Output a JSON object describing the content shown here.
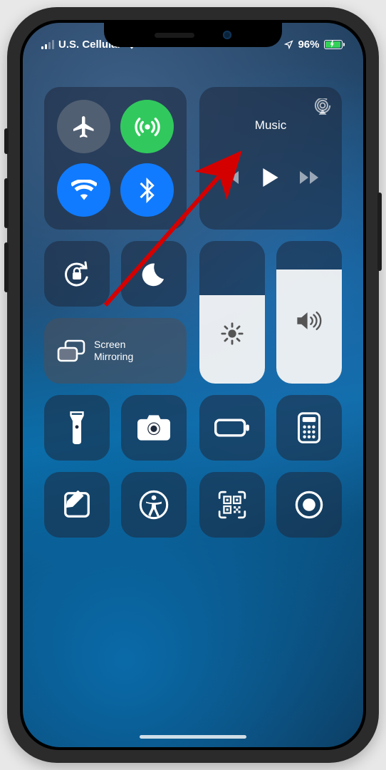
{
  "statusbar": {
    "carrier": "U.S. Cellular",
    "battery_pct": "96%"
  },
  "music": {
    "title": "Music"
  },
  "screenMirroring": {
    "line1": "Screen",
    "line2": "Mirroring"
  },
  "sliders": {
    "brightness_pct": 62,
    "volume_pct": 80
  }
}
